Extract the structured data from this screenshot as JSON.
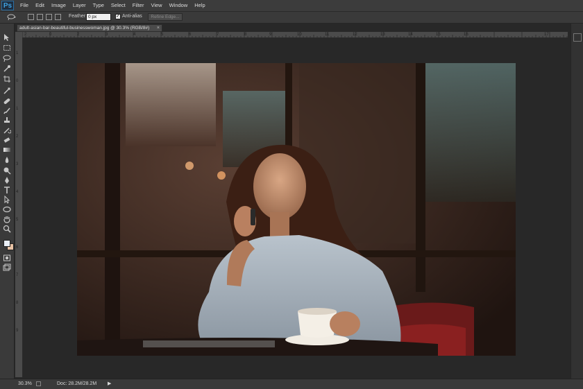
{
  "app": {
    "logo": "Ps"
  },
  "menu": [
    "File",
    "Edit",
    "Image",
    "Layer",
    "Type",
    "Select",
    "Filter",
    "View",
    "Window",
    "Help"
  ],
  "options": {
    "feather_label": "Feather:",
    "feather_value": "0 px",
    "antialias_label": "Anti-alias",
    "antialias_checked": true,
    "refine_label": "Refine Edge..."
  },
  "document": {
    "tab_title": "adult-asian-bar-beautiful-businesswoman.jpg @ 30.3% (RGB/8#)",
    "close_symbol": "×"
  },
  "ruler": {
    "top": [
      "2",
      "0",
      "2",
      "3",
      "4",
      "5",
      "6",
      "7",
      "8",
      "9",
      "10",
      "11",
      "12",
      "13",
      "14",
      "15",
      "16",
      "17"
    ],
    "left": [
      "1",
      "0",
      "1",
      "2",
      "3",
      "4",
      "5",
      "6",
      "7",
      "8",
      "9"
    ]
  },
  "tools": [
    "move-icon",
    "marquee-icon",
    "lasso-icon",
    "quick-select-icon",
    "crop-icon",
    "eyedropper-icon",
    "healing-icon",
    "brush-icon",
    "stamp-icon",
    "history-brush-icon",
    "eraser-icon",
    "gradient-icon",
    "blur-icon",
    "dodge-icon",
    "pen-icon",
    "type-icon",
    "path-select-icon",
    "shape-icon",
    "hand-icon",
    "zoom-icon",
    "color-swatch-icon",
    "quick-mask-icon",
    "screen-mode-icon"
  ],
  "status": {
    "zoom": "30.3%",
    "doc": "Doc: 28.2M/28.2M",
    "arrow": "▶"
  },
  "colors": {
    "foreground": "#e9eef5",
    "background": "#e8c2a4"
  }
}
